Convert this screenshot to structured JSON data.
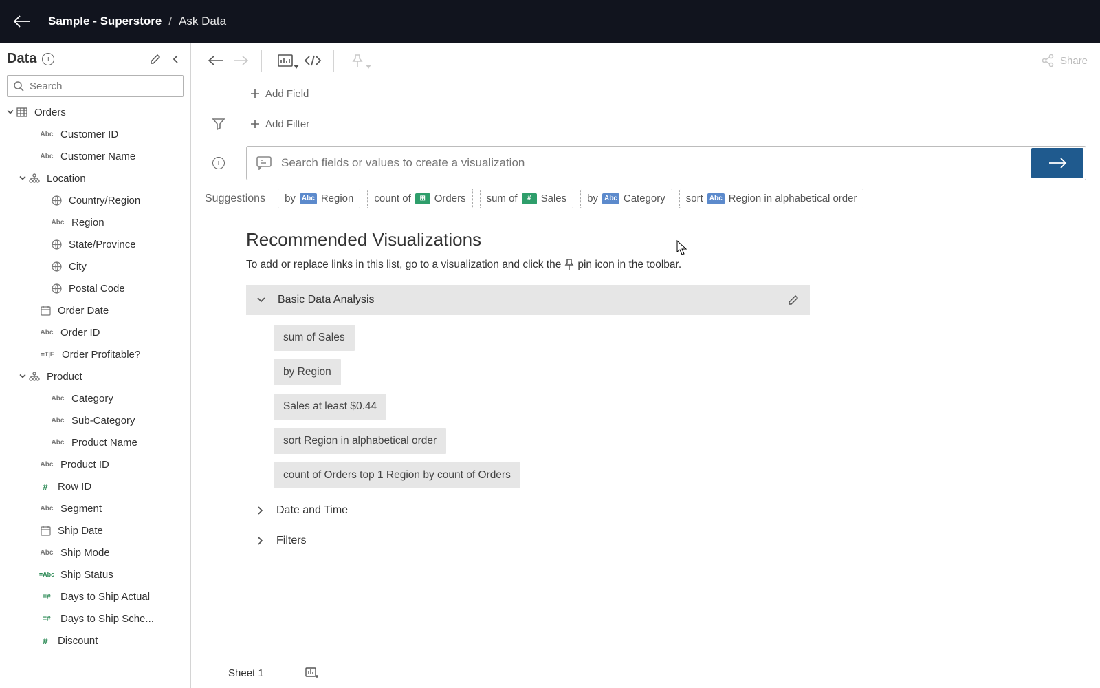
{
  "topbar": {
    "crumb_main": "Sample - Superstore",
    "crumb_sep": "/",
    "crumb_sub": "Ask Data"
  },
  "sidebar": {
    "title": "Data",
    "search_placeholder": "Search",
    "tree": [
      {
        "label": "Orders",
        "type": "table",
        "indent": 0,
        "caret": "down"
      },
      {
        "label": "Customer ID",
        "type": "abc",
        "indent": 1
      },
      {
        "label": "Customer Name",
        "type": "abc",
        "indent": 1
      },
      {
        "label": "Location",
        "type": "hier",
        "indent": 1,
        "caret": "down",
        "caretIndent": true
      },
      {
        "label": "Country/Region",
        "type": "globe",
        "indent": 2
      },
      {
        "label": "Region",
        "type": "abc",
        "indent": 2
      },
      {
        "label": "State/Province",
        "type": "globe",
        "indent": 2
      },
      {
        "label": "City",
        "type": "globe",
        "indent": 2
      },
      {
        "label": "Postal Code",
        "type": "globe",
        "indent": 2
      },
      {
        "label": "Order Date",
        "type": "date",
        "indent": 1
      },
      {
        "label": "Order ID",
        "type": "abc",
        "indent": 1
      },
      {
        "label": "Order Profitable?",
        "type": "tf",
        "indent": 1
      },
      {
        "label": "Product",
        "type": "hier",
        "indent": 1,
        "caret": "down",
        "caretIndent": true
      },
      {
        "label": "Category",
        "type": "abc",
        "indent": 2
      },
      {
        "label": "Sub-Category",
        "type": "abc",
        "indent": 2
      },
      {
        "label": "Product Name",
        "type": "abc",
        "indent": 2
      },
      {
        "label": "Product ID",
        "type": "abc",
        "indent": 1
      },
      {
        "label": "Row ID",
        "type": "hash",
        "indent": 1
      },
      {
        "label": "Segment",
        "type": "abc",
        "indent": 1
      },
      {
        "label": "Ship Date",
        "type": "date",
        "indent": 1
      },
      {
        "label": "Ship Mode",
        "type": "abc",
        "indent": 1
      },
      {
        "label": "Ship Status",
        "type": "calcabc",
        "indent": 1
      },
      {
        "label": "Days to Ship Actual",
        "type": "calc",
        "indent": 1
      },
      {
        "label": "Days to Ship Sche...",
        "type": "calc",
        "indent": 1
      },
      {
        "label": "Discount",
        "type": "hash",
        "indent": 1
      }
    ]
  },
  "toolbar": {
    "share_label": "Share"
  },
  "workspace": {
    "add_field": "Add Field",
    "add_filter": "Add Filter",
    "query_placeholder": "Search fields or values to create a visualization",
    "suggestions_label": "Suggestions",
    "suggestions": [
      {
        "pre": "by",
        "tag": "Abc",
        "tagClass": "tag-abc",
        "post": "Region"
      },
      {
        "pre": "count of",
        "tag": "⊞",
        "tagClass": "tag-table",
        "post": "Orders"
      },
      {
        "pre": "sum of",
        "tag": "#",
        "tagClass": "tag-hash",
        "post": "Sales"
      },
      {
        "pre": "by",
        "tag": "Abc",
        "tagClass": "tag-abc",
        "post": "Category"
      },
      {
        "pre": "sort",
        "tag": "Abc",
        "tagClass": "tag-abc",
        "post": "Region in alphabetical order"
      }
    ],
    "rec_title": "Recommended Visualizations",
    "rec_desc_pre": "To add or replace links in this list, go to a visualization and click the",
    "rec_desc_post": "pin icon in the toolbar.",
    "group_expanded_label": "Basic Data Analysis",
    "rec_items": [
      "sum of Sales",
      "by Region",
      "Sales at least $0.44",
      "sort Region in alphabetical order",
      "count of Orders top 1 Region by count of Orders"
    ],
    "group_collapsed_1": "Date and Time",
    "group_collapsed_2": "Filters"
  },
  "sheets": {
    "tab": "Sheet 1"
  }
}
